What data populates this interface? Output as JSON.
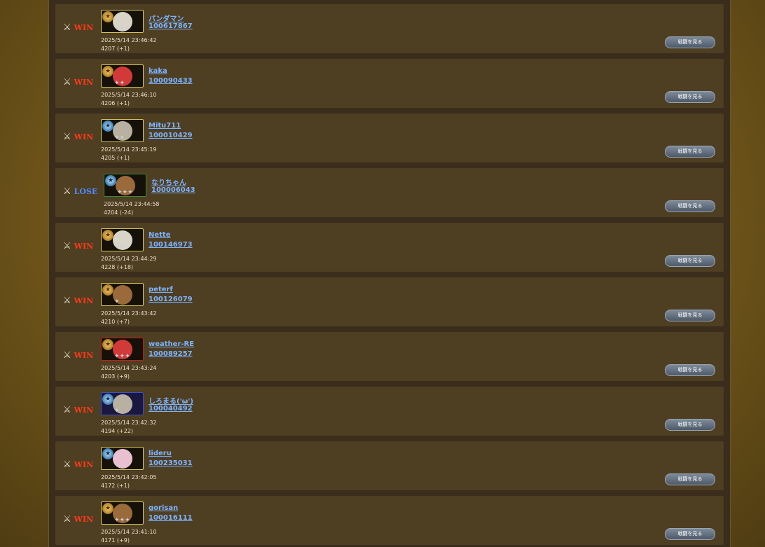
{
  "battles": [
    {
      "result": "WIN",
      "name": "パンダマン",
      "id": "100617867",
      "date": "2025/5/14 23:46:42",
      "rate": "4207 (+1)",
      "button": "戦闘を見る"
    },
    {
      "result": "WIN",
      "name": "kaka",
      "id": "100090433",
      "date": "2025/5/14 23:46:10",
      "rate": "4206 (+1)",
      "button": "戦闘を見る"
    },
    {
      "result": "WIN",
      "name": "Mitu711",
      "id": "100010429",
      "date": "2025/5/14 23:45:19",
      "rate": "4205 (+1)",
      "button": "戦闘を見る"
    },
    {
      "result": "LOSE",
      "name": "なりちゃん",
      "id": "100006043",
      "date": "2025/5/14 23:44:58",
      "rate": "4204 (-24)",
      "button": "戦闘を見る"
    },
    {
      "result": "WIN",
      "name": "Nette",
      "id": "100146973",
      "date": "2025/5/14 23:44:29",
      "rate": "4228 (+18)",
      "button": "戦闘を見る"
    },
    {
      "result": "WIN",
      "name": "peterf",
      "id": "100126079",
      "date": "2025/5/14 23:43:42",
      "rate": "4210 (+7)",
      "button": "戦闘を見る"
    },
    {
      "result": "WIN",
      "name": "weather-RE",
      "id": "100089257",
      "date": "2025/5/14 23:43:24",
      "rate": "4203 (+9)",
      "button": "戦闘を見る"
    },
    {
      "result": "WIN",
      "name": "しろまる('ω')",
      "id": "100040492",
      "date": "2025/5/14 23:42:32",
      "rate": "4194 (+22)",
      "button": "戦闘を見る"
    },
    {
      "result": "WIN",
      "name": "lideru",
      "id": "100235031",
      "date": "2025/5/14 23:42:05",
      "rate": "4172 (+1)",
      "button": "戦闘を見る"
    },
    {
      "result": "WIN",
      "name": "gorisan",
      "id": "100016111",
      "date": "2025/5/14 23:41:10",
      "rate": "4171 (+9)",
      "button": "戦闘を見る"
    }
  ],
  "icons": {
    "result_icon": "crossed-swords-icon",
    "avatar": "player-avatar"
  },
  "colors": {
    "win": "#ff3a1a",
    "lose": "#4d8cff",
    "link": "#7db4ff",
    "row_bg": "#4e3e22"
  }
}
